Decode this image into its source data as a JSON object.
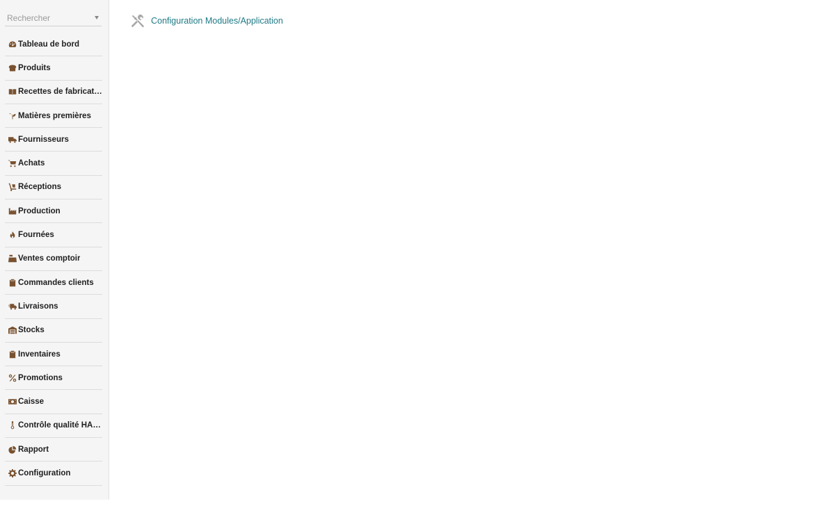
{
  "search": {
    "placeholder": "Rechercher"
  },
  "sidebar": {
    "items": [
      {
        "label": "Tableau de bord",
        "icon": "dashboard-gauge-icon"
      },
      {
        "label": "Produits",
        "icon": "bread-icon"
      },
      {
        "label": "Recettes de fabrication",
        "icon": "open-book-icon"
      },
      {
        "label": "Matières premières",
        "icon": "seedling-icon"
      },
      {
        "label": "Fournisseurs",
        "icon": "truck-icon"
      },
      {
        "label": "Achats",
        "icon": "cart-icon"
      },
      {
        "label": "Réceptions",
        "icon": "dolly-icon"
      },
      {
        "label": "Production",
        "icon": "factory-icon"
      },
      {
        "label": "Fournées",
        "icon": "fire-icon"
      },
      {
        "label": "Ventes comptoir",
        "icon": "cash-register-icon"
      },
      {
        "label": "Commandes clients",
        "icon": "clipboard-check-icon"
      },
      {
        "label": "Livraisons",
        "icon": "fast-truck-icon"
      },
      {
        "label": "Stocks",
        "icon": "warehouse-icon"
      },
      {
        "label": "Inventaires",
        "icon": "clipboard-list-icon"
      },
      {
        "label": "Promotions",
        "icon": "percent-icon"
      },
      {
        "label": "Caisse",
        "icon": "money-bill-icon"
      },
      {
        "label": "Contrôle qualité HACCP",
        "icon": "thermometer-icon"
      },
      {
        "label": "Rapport",
        "icon": "pie-chart-icon"
      },
      {
        "label": "Configuration",
        "icon": "gear-icon"
      }
    ]
  },
  "main": {
    "breadcrumb": {
      "label": "Configuration Modules/Application",
      "icon": "tools-icon"
    }
  },
  "colors": {
    "icon": "#7a5230",
    "link": "#1f7a86",
    "sidebar_bg": "#f5f5f5",
    "tools_icon": "#9e9e9e"
  }
}
